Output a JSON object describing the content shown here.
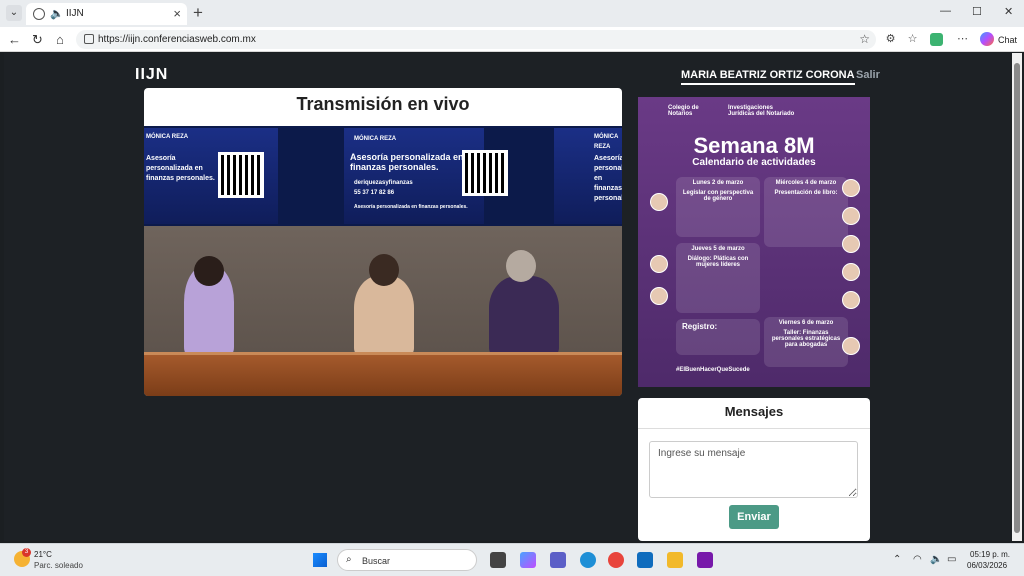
{
  "browser": {
    "tab_title": "IIJN",
    "url": "https://iijn.conferenciasweb.com.mx",
    "chat_label": "Chat"
  },
  "header": {
    "logo": "IIJN",
    "user_name": "MARIA BEATRIZ ORTIZ CORONA",
    "logout_label": "Salir"
  },
  "stream": {
    "title": "Transmisión en vivo",
    "screen_brand": "MÓNICA REZA",
    "screen_headline": "Asesoría personalizada en finanzas personales.",
    "screen_handle": "deriquezasyfinanzas",
    "screen_phone": "55 37 17 82 86",
    "screen_caption": "Asesoría personalizada en finanzas personales."
  },
  "poster": {
    "org1": "Colegio de Notarios",
    "org2": "Investigaciones Jurídicas del Notariado",
    "title": "Semana 8M",
    "subtitle": "Calendario de actividades",
    "day1": "Lunes 2 de marzo",
    "day1_event": "Legislar con perspectiva de género",
    "day2": "Miércoles 4 de marzo",
    "day2_event": "Presentación de libro:",
    "day3": "Jueves 5 de marzo",
    "day3_event": "Diálogo: Pláticas con mujeres líderes",
    "day4": "Viernes 6 de marzo",
    "day4_event": "Taller: Finanzas personales estratégicas para abogadas",
    "registro": "Registro:",
    "hashtag": "#ElBuenHacerQueSucede"
  },
  "messages": {
    "title": "Mensajes",
    "placeholder": "Ingrese su mensaje",
    "send_label": "Enviar"
  },
  "taskbar": {
    "temperature": "21°C",
    "weather": "Parc. soleado",
    "weather_badge": "3",
    "search_label": "Buscar",
    "time": "05:19 p. m.",
    "date": "06/03/2026"
  }
}
